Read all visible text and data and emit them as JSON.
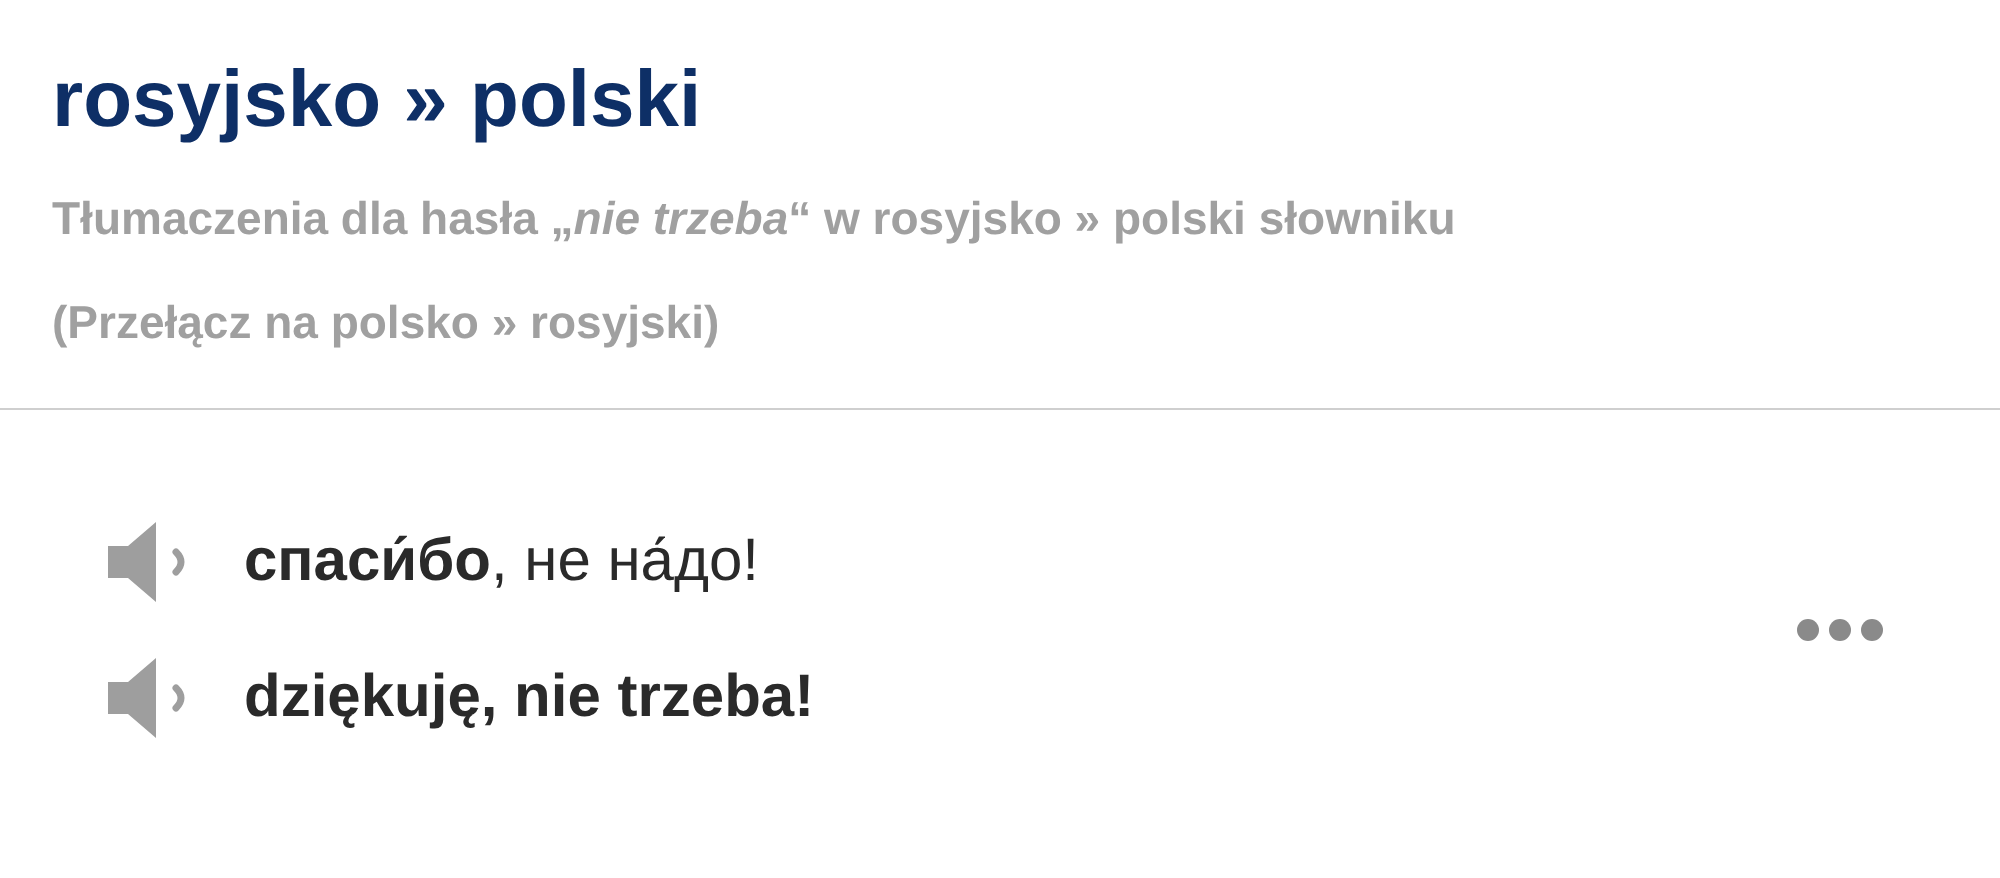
{
  "title": "rosyjsko » polski",
  "subtitle": "Tłumaczenia dla hasła „*nie trzeba*“ w rosyjsko » polski słowniku",
  "switch_link": "(Przełącz na polsko » rosyjski)",
  "entries": [
    {
      "kind": "source",
      "text": "**спаси́бо**, не на́до!"
    },
    {
      "kind": "target",
      "text": "dziękuję, nie trzeba!"
    }
  ]
}
